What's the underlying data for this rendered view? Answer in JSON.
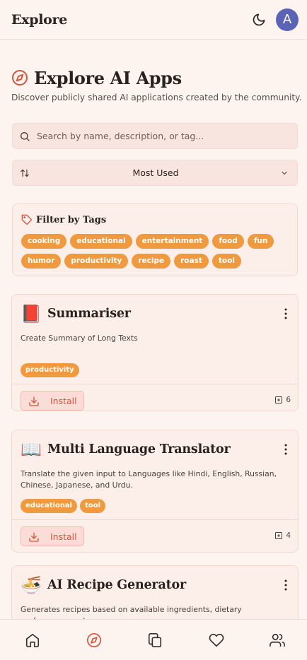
{
  "app": {
    "title": "Explore",
    "avatar_letter": "A"
  },
  "page": {
    "title": "Explore AI Apps",
    "subtitle": "Discover publicly shared AI applications created by the community."
  },
  "search": {
    "placeholder": "Search by name, description, or tag...",
    "value": ""
  },
  "sort": {
    "selected": "Most Used"
  },
  "filter": {
    "title": "Filter by Tags",
    "tags": [
      "cooking",
      "educational",
      "entertainment",
      "food",
      "fun",
      "humor",
      "productivity",
      "recipe",
      "roast",
      "tool"
    ]
  },
  "apps": [
    {
      "emoji": "📕",
      "name": "Summariser",
      "description": "Create Summary of Long Texts",
      "tags": [
        "productivity"
      ],
      "install_label": "Install",
      "install_count": "6"
    },
    {
      "emoji": "📖",
      "name": "Multi Language Translator",
      "description": "Translate the given input to Languages like Hindi, English, Russian, Chinese, Japanese, and Urdu.",
      "tags": [
        "educational",
        "tool"
      ],
      "install_label": "Install",
      "install_count": "4"
    },
    {
      "emoji": "🍜",
      "name": "AI Recipe Generator",
      "description": "Generates recipes based on available ingredients, dietary preferences, and",
      "tags": [],
      "install_label": "",
      "install_count": ""
    }
  ],
  "colors": {
    "accent": "#d6533f",
    "tag": "#ef9a3e",
    "avatar": "#5b63b7",
    "background": "#fdf4ef"
  },
  "icons": {
    "theme": "moon-icon",
    "heading": "compass-icon",
    "search": "search-icon",
    "sort": "sort-icon",
    "dropdown": "chevron-down-icon",
    "filter": "tag-icon",
    "menu": "more-vertical-icon",
    "install": "download-icon",
    "count": "plus-square-icon",
    "nav": [
      "home-icon",
      "compass-icon",
      "copy-icon",
      "heart-icon",
      "users-icon"
    ]
  }
}
